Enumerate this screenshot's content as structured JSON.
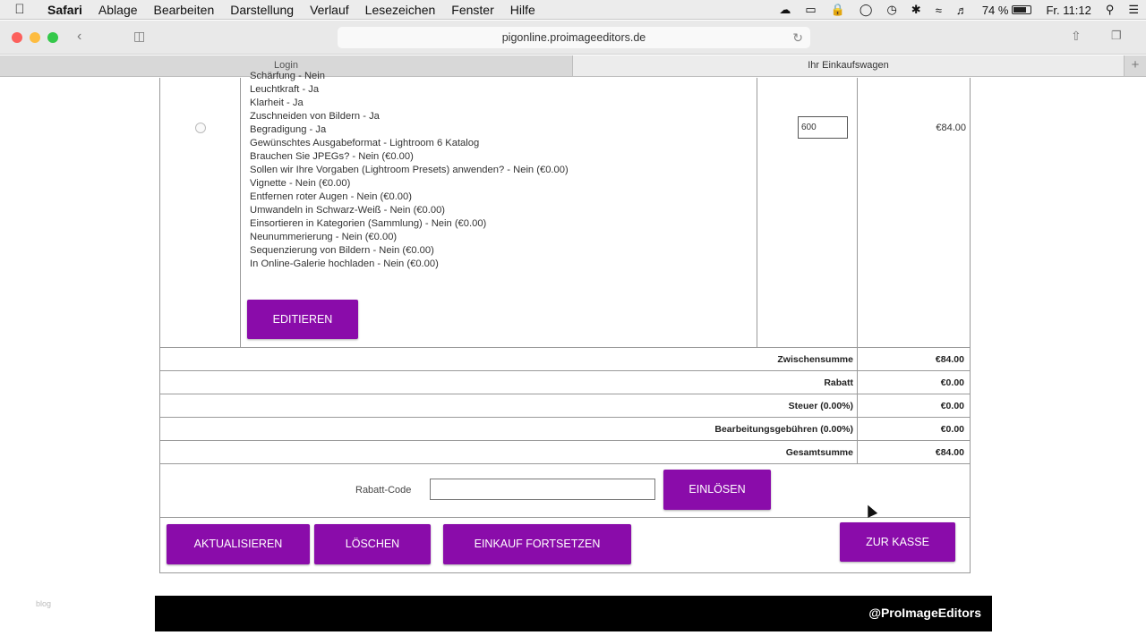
{
  "menubar": {
    "apple": "",
    "items": [
      "Safari",
      "Ablage",
      "Bearbeiten",
      "Darstellung",
      "Verlauf",
      "Lesezeichen",
      "Fenster",
      "Hilfe"
    ],
    "battery_percent": "74 %",
    "battery_level": 0.74,
    "clock": "Fr. 11:12"
  },
  "browser": {
    "url": "pigonline.proimageeditors.de",
    "tabs": [
      {
        "label": "Login",
        "active": false
      },
      {
        "label": "Ihr Einkaufswagen",
        "active": true
      }
    ]
  },
  "cart": {
    "options": [
      "Schärfung - Nein",
      "Leuchtkraft - Ja",
      "Klarheit - Ja",
      "Zuschneiden von Bildern - Ja",
      "Begradigung - Ja",
      "Gewünschtes Ausgabeformat - Lightroom 6 Katalog",
      "Brauchen Sie JPEGs? - Nein (€0.00)",
      "Sollen wir Ihre Vorgaben (Lightroom Presets) anwenden? - Nein (€0.00)",
      "Vignette - Nein (€0.00)",
      "Entfernen roter Augen - Nein (€0.00)",
      "Umwandeln in Schwarz-Weiß - Nein (€0.00)",
      "Einsortieren in Kategorien (Sammlung) - Nein (€0.00)",
      "Neunummerierung - Nein (€0.00)",
      "Sequenzierung von Bildern - Nein (€0.00)",
      "In Online-Galerie hochladen - Nein (€0.00)"
    ],
    "quantity": "600",
    "line_price": "€84.00",
    "edit_label": "EDITIEREN",
    "summary": [
      {
        "label": "Zwischensumme",
        "value": "€84.00"
      },
      {
        "label": "Rabatt",
        "value": "€0.00"
      },
      {
        "label": "Steuer (0.00%)",
        "value": "€0.00"
      },
      {
        "label": "Bearbeitungsgebühren (0.00%)",
        "value": "€0.00"
      },
      {
        "label": "Gesamtsumme",
        "value": "€84.00"
      }
    ],
    "coupon_label": "Rabatt-Code",
    "coupon_value": "",
    "redeem_label": "EINLÖSEN",
    "update_label": "AKTUALISIEREN",
    "delete_label": "LÖSCHEN",
    "continue_label": "EINKAUF FORTSETZEN",
    "checkout_label": "ZUR KASSE"
  },
  "footer": {
    "brand": "@ProImageEditors"
  },
  "colors": {
    "button": "#8a0caa",
    "footer": "#000000"
  }
}
